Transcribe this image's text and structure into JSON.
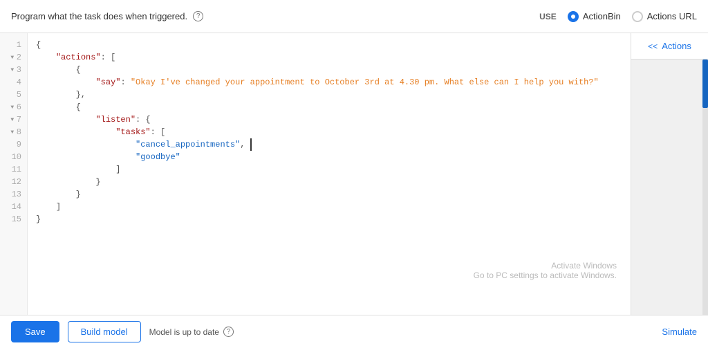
{
  "header": {
    "description": "Program what the task does when triggered.",
    "help_tooltip": "?",
    "use_label": "USE",
    "radio_options": [
      {
        "id": "actionbin",
        "label": "ActionBin",
        "selected": true
      },
      {
        "id": "actions_url",
        "label": "Actions URL",
        "selected": false
      }
    ]
  },
  "editor": {
    "lines": [
      {
        "num": 1,
        "has_arrow": false,
        "content": "{"
      },
      {
        "num": 2,
        "has_arrow": true,
        "content": "    \"actions\": ["
      },
      {
        "num": 3,
        "has_arrow": true,
        "content": "        {"
      },
      {
        "num": 4,
        "has_arrow": false,
        "content": "            \"say\": \"Okay I've changed your appointment to October 3rd at 4.30 pm. What else can I help you with?\""
      },
      {
        "num": 5,
        "has_arrow": false,
        "content": "        },"
      },
      {
        "num": 6,
        "has_arrow": true,
        "content": "        {"
      },
      {
        "num": 7,
        "has_arrow": true,
        "content": "            \"listen\": {"
      },
      {
        "num": 8,
        "has_arrow": true,
        "content": "                \"tasks\": ["
      },
      {
        "num": 9,
        "has_arrow": false,
        "content": "                    \"cancel_appointments\","
      },
      {
        "num": 10,
        "has_arrow": false,
        "content": "                    \"goodbye\""
      },
      {
        "num": 11,
        "has_arrow": false,
        "content": "                ]"
      },
      {
        "num": 12,
        "has_arrow": false,
        "content": "            }"
      },
      {
        "num": 13,
        "has_arrow": false,
        "content": "        }"
      },
      {
        "num": 14,
        "has_arrow": false,
        "content": "    ]"
      },
      {
        "num": 15,
        "has_arrow": false,
        "content": "}"
      }
    ]
  },
  "actions_panel": {
    "chevron": "<<",
    "label": "Actions"
  },
  "footer": {
    "save_label": "Save",
    "build_label": "Build model",
    "status_text": "Model is up to date",
    "help_tooltip": "?",
    "simulate_label": "Simulate"
  },
  "watermark": {
    "line1": "Activate Windows",
    "line2": "Go to PC settings to activate Windows."
  }
}
